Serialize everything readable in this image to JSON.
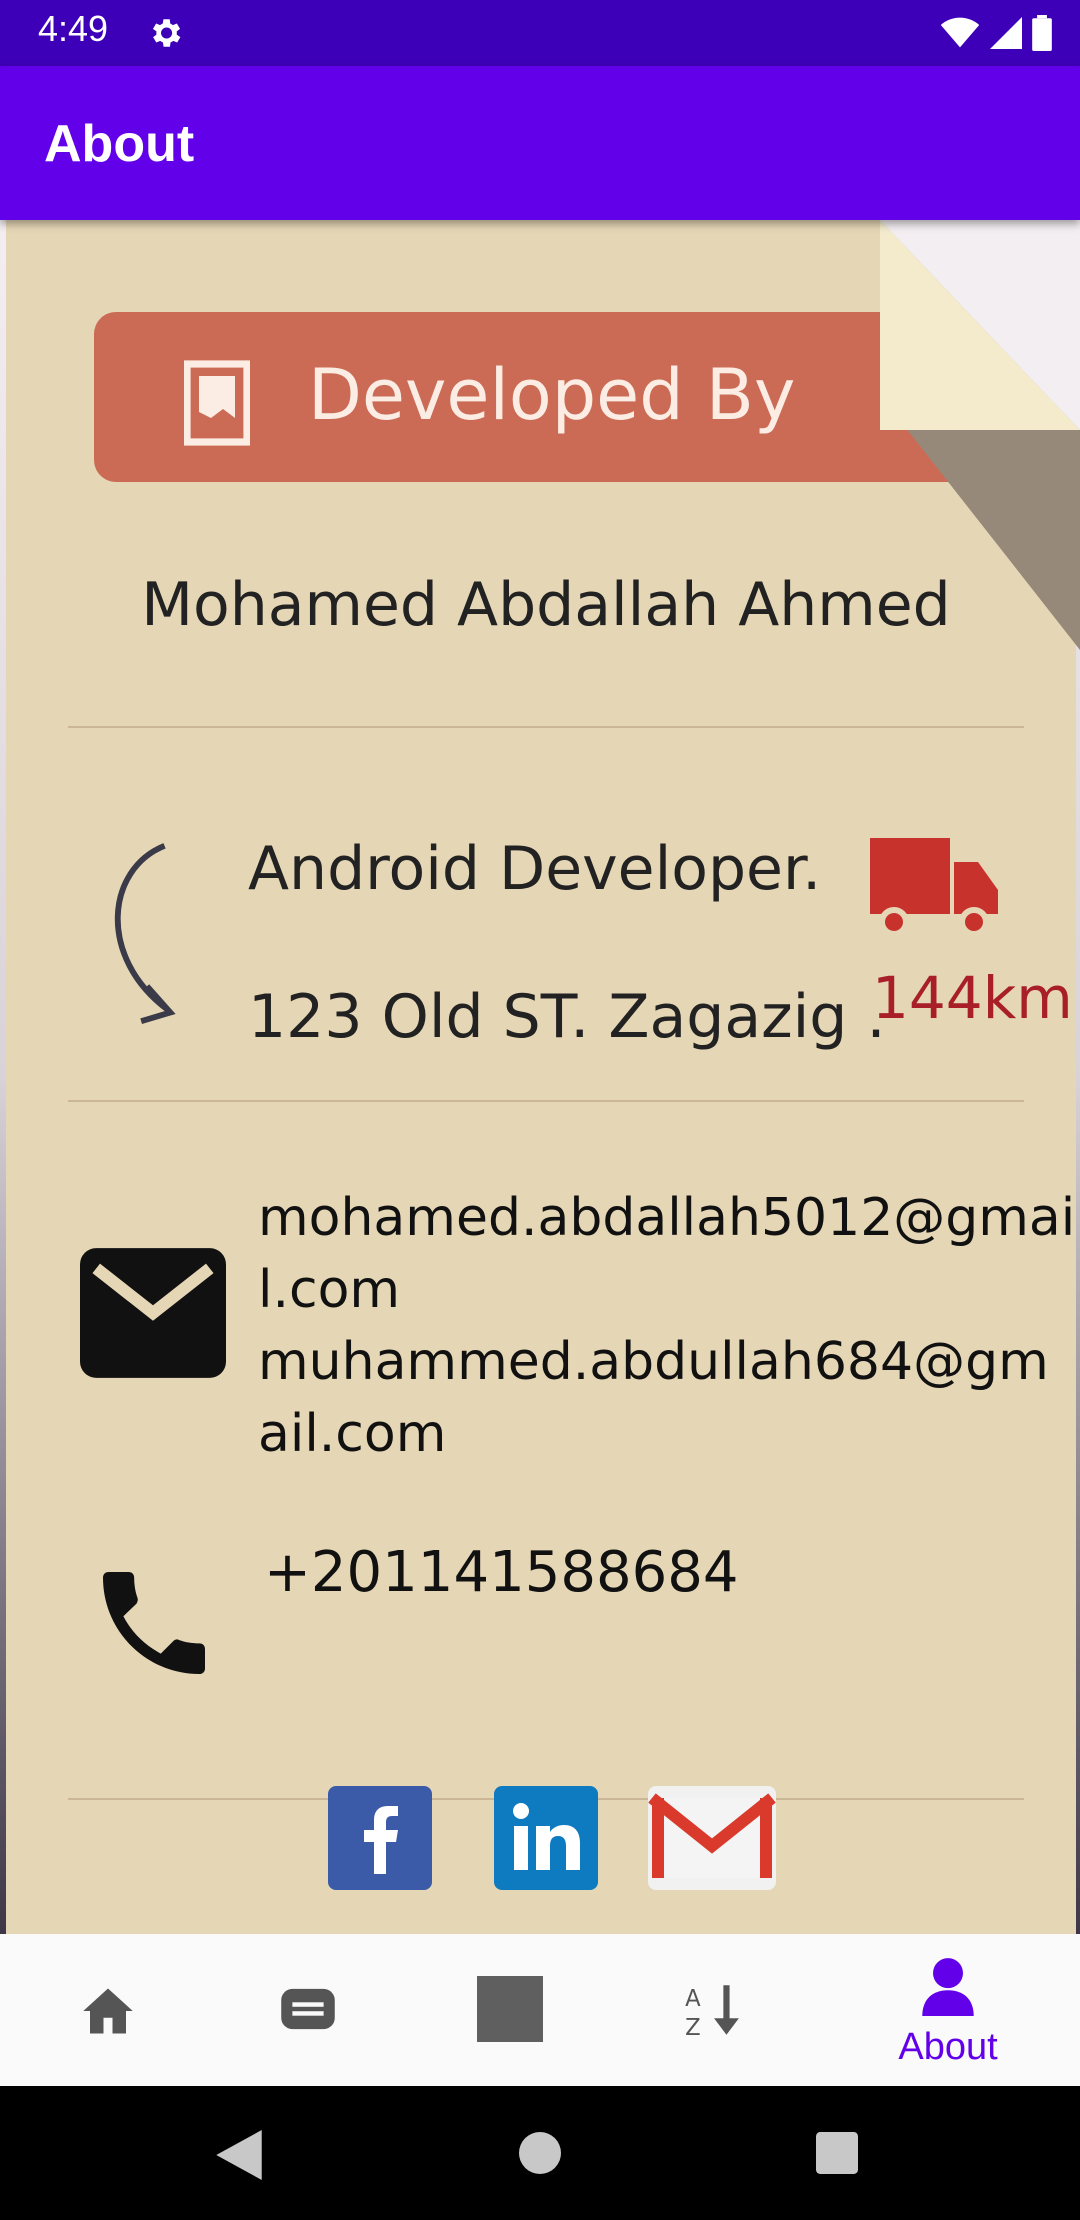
{
  "status_bar": {
    "time": "4:49"
  },
  "app_bar": {
    "title": "About"
  },
  "card": {
    "ribbon_title": "Developed By",
    "developer_name": "Mohamed Abdallah Ahmed",
    "job_title": "Android Developer.",
    "address": "123 Old ST. Zagazig .",
    "distance": "144km",
    "email_primary": "mohamed.abdallah5012@gmail.com",
    "email_secondary": "muhammed.abdullah684@gmail.com",
    "phone": "+201141588684",
    "social": [
      "facebook",
      "linkedin",
      "gmail"
    ]
  },
  "bottom_nav": {
    "items": [
      {
        "icon": "home-icon",
        "label": ""
      },
      {
        "icon": "message-icon",
        "label": ""
      },
      {
        "icon": "square-icon",
        "label": ""
      },
      {
        "icon": "sort-az-icon",
        "label": ""
      },
      {
        "icon": "person-icon",
        "label": "About",
        "selected": true
      }
    ]
  },
  "colors": {
    "app_bar": "#6200ea",
    "status_bar": "#3d00b8",
    "paper": "#e5d6b5",
    "ribbon": "#cb6b55",
    "accent_red": "#a81f2a"
  }
}
